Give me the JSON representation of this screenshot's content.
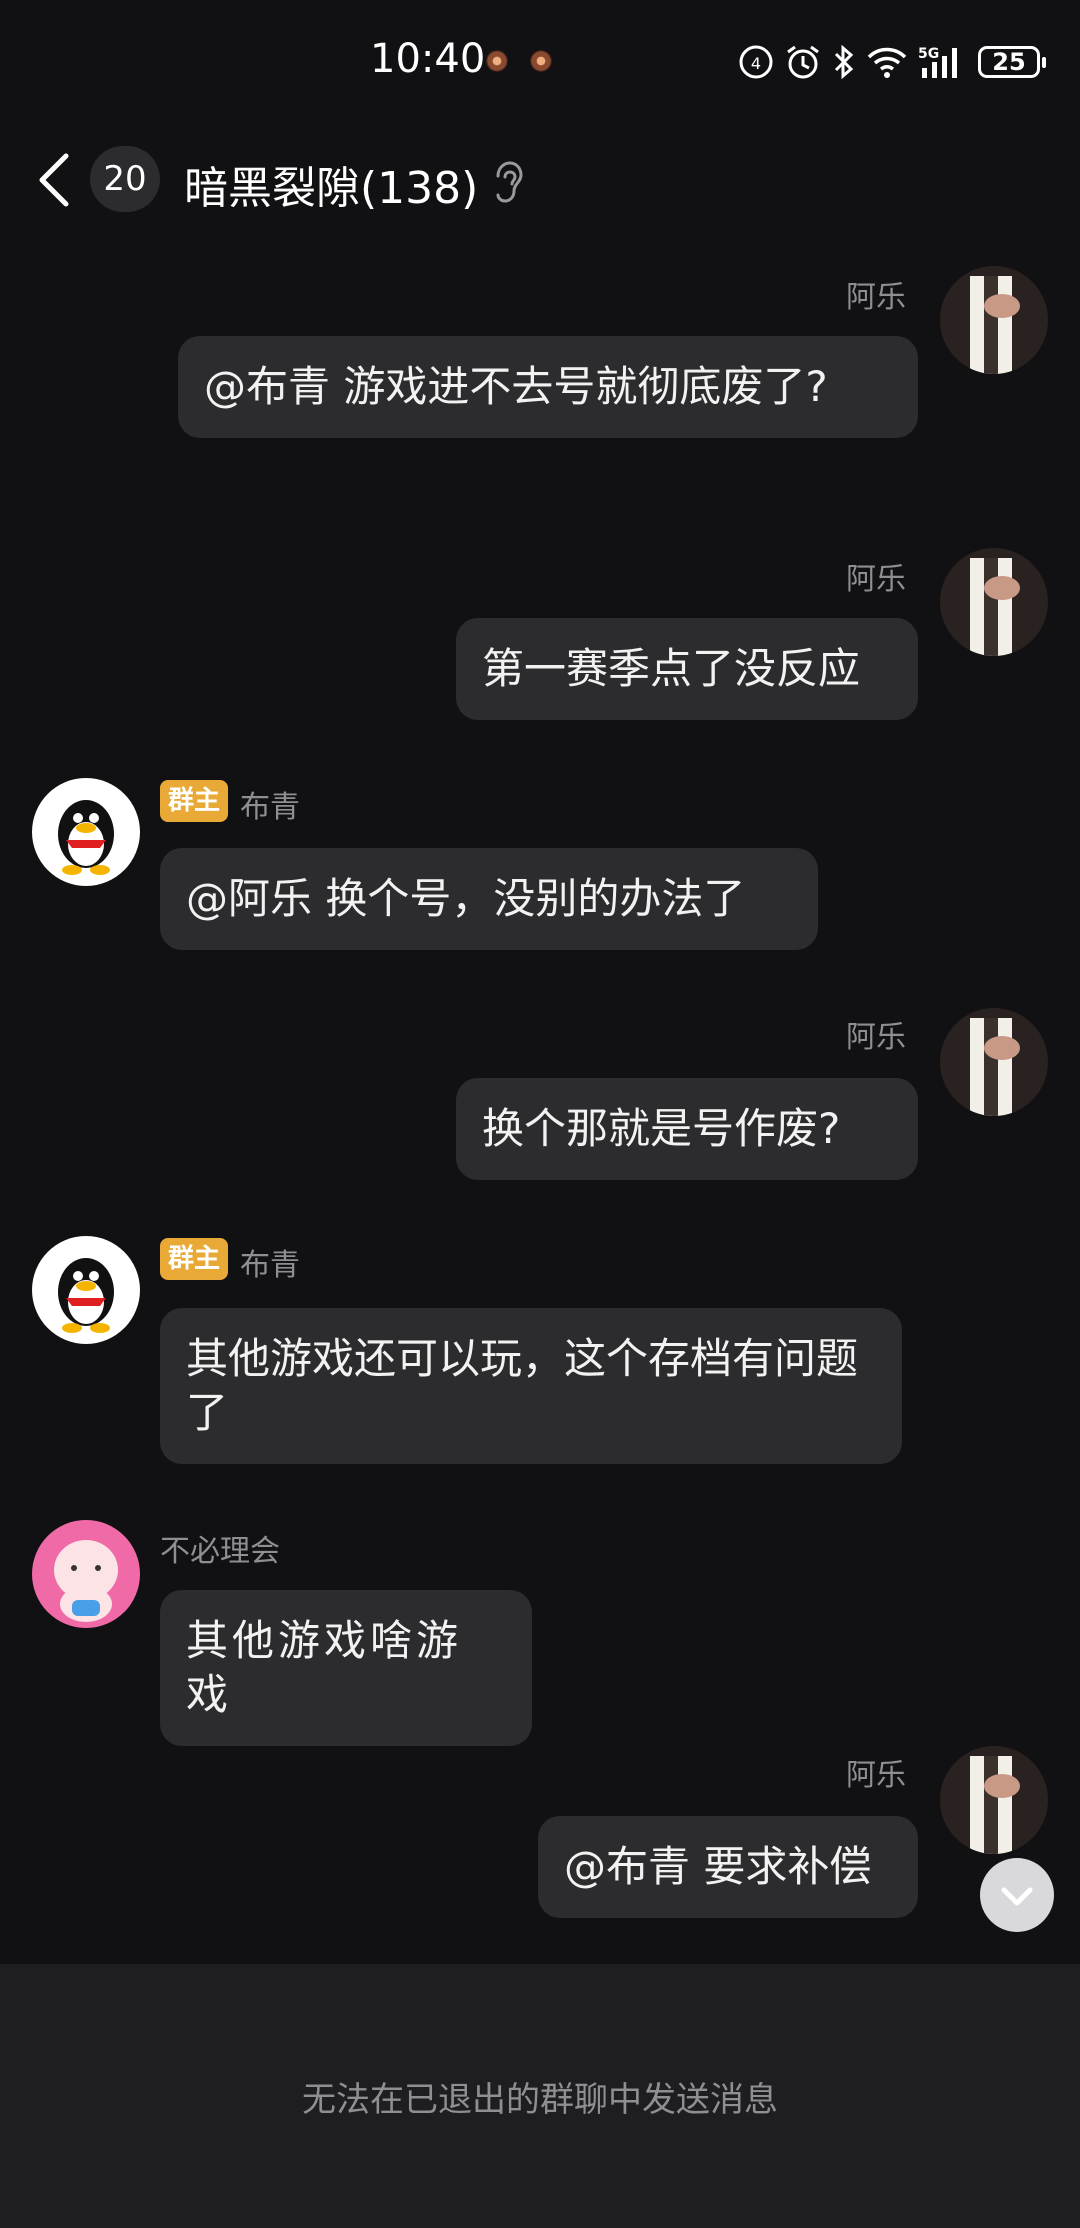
{
  "status_bar": {
    "time": "10:40",
    "battery": "25",
    "network": "5G"
  },
  "header": {
    "unread_count": "20",
    "title": "暗黑裂隙(138)"
  },
  "messages": [
    {
      "sender": "阿乐",
      "side": "right",
      "text": "@布青 游戏进不去号就彻底废了?"
    },
    {
      "sender": "阿乐",
      "side": "right",
      "text": "第一赛季点了没反应"
    },
    {
      "sender": "布青",
      "badge": "群主",
      "side": "left",
      "text": "@阿乐 换个号，没别的办法了"
    },
    {
      "sender": "阿乐",
      "side": "right",
      "text": "换个那就是号作废?"
    },
    {
      "sender": "布青",
      "badge": "群主",
      "side": "left",
      "text": "其他游戏还可以玩，这个存档有问题了"
    },
    {
      "sender": "不必理会",
      "side": "left",
      "text": "其他游戏啥游戏"
    },
    {
      "sender": "阿乐",
      "side": "right",
      "text": "@布青 要求补偿"
    }
  ],
  "footer": {
    "notice": "无法在已退出的群聊中发送消息"
  },
  "colors": {
    "background": "#111113",
    "bubble": "#2c2c2e",
    "owner_badge": "#e9a936"
  }
}
